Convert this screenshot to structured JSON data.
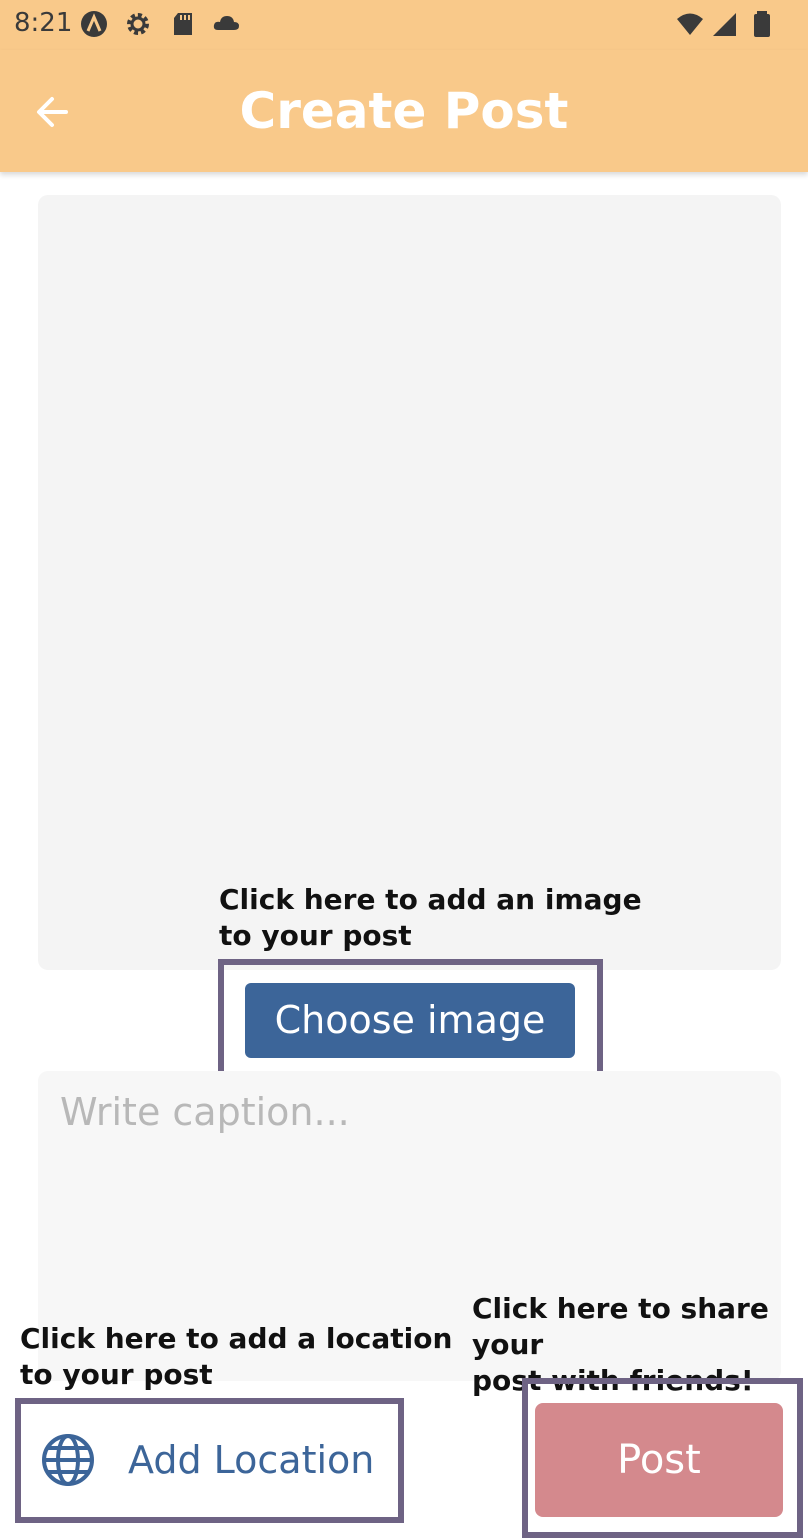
{
  "status_bar": {
    "time": "8:21",
    "left_icons": [
      "app-a-icon",
      "settings-gear-icon",
      "sd-card-icon",
      "cloud-icon"
    ],
    "right_icons": [
      "wifi-icon",
      "signal-icon",
      "battery-icon"
    ]
  },
  "app_bar": {
    "title": "Create Post",
    "back_icon": "arrow-back-icon",
    "color": "#f9c98a"
  },
  "image_section": {
    "hint": "Click here to add an image\nto your post",
    "button_label": "Choose image",
    "button_color": "#3c6599"
  },
  "caption": {
    "placeholder": "Write caption..."
  },
  "location": {
    "hint": "Click here to add a location\nto your post",
    "button_label": "Add Location",
    "icon": "globe-icon"
  },
  "post": {
    "hint": "Click here to share your\npost with friends!",
    "button_label": "Post",
    "button_color": "#d4898d"
  },
  "highlight_color": "#6e6384"
}
